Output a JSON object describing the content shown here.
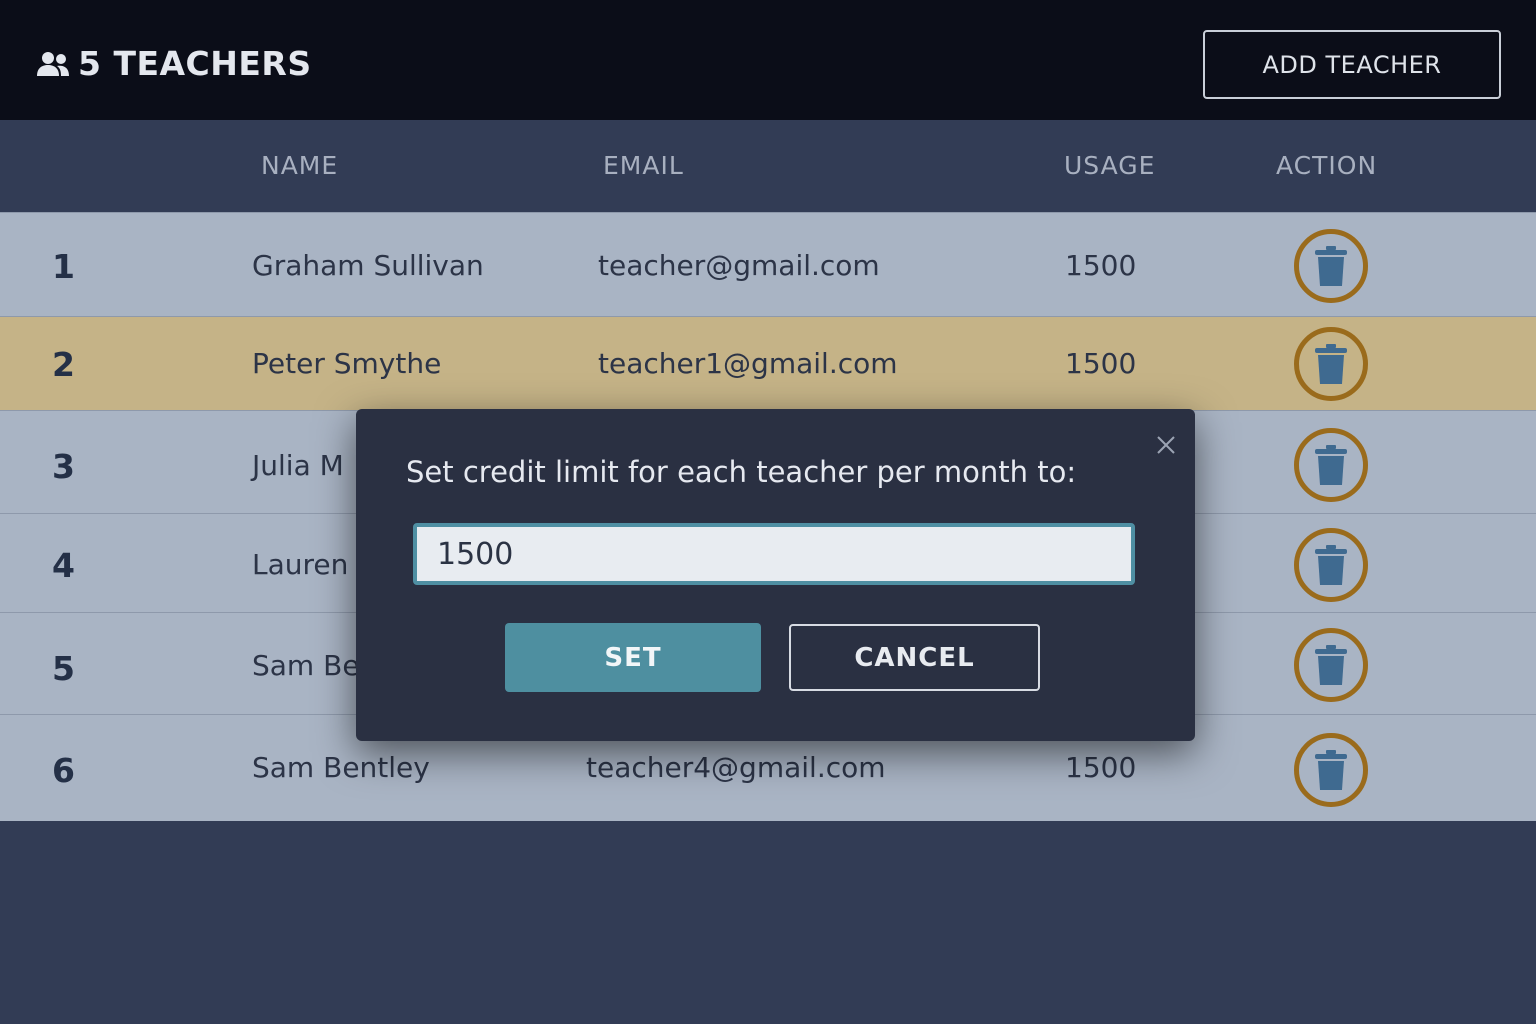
{
  "header": {
    "title": "5 TEACHERS",
    "title_icon": "users-icon",
    "add_button_label": "ADD TEACHER"
  },
  "table": {
    "columns": [
      "NAME",
      "EMAIL",
      "USAGE",
      "ACTION"
    ],
    "rows": [
      {
        "index": "1",
        "name": "Graham Sullivan",
        "email": "teacher@gmail.com",
        "usage": "1500"
      },
      {
        "index": "2",
        "name": "Peter Smythe",
        "email": "teacher1@gmail.com",
        "usage": "1500",
        "highlighted": true
      },
      {
        "index": "3",
        "name": "Julia M",
        "email": "",
        "usage": ""
      },
      {
        "index": "4",
        "name": "Lauren",
        "email": "",
        "usage": ""
      },
      {
        "index": "5",
        "name": "Sam Be",
        "email": "",
        "usage": ""
      },
      {
        "index": "6",
        "name": "Sam Bentley",
        "email": "teacher4@gmail.com",
        "usage": "1500"
      }
    ],
    "action_icon": "trash-icon"
  },
  "modal": {
    "message": "Set credit limit for each teacher per month to:",
    "input_value": "1500",
    "set_label": "SET",
    "cancel_label": "CANCEL",
    "close_icon": "close-icon"
  },
  "colors": {
    "topbar": "#0b0d18",
    "row": "#a9b4c4",
    "row_highlight": "#c5b387",
    "accent": "#4e8fa0",
    "delete_ring": "#9a6b1c",
    "trash": "#3f6a90"
  }
}
